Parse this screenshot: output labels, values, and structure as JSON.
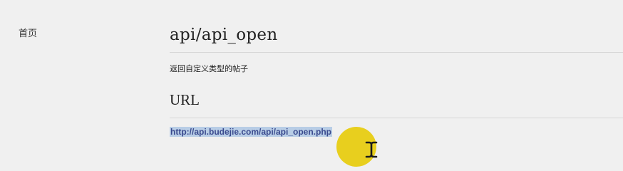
{
  "sidebar": {
    "items": [
      {
        "label": "首页"
      }
    ]
  },
  "main": {
    "title": "api/api_open",
    "description": "返回自定义类型的帖子",
    "url_heading": "URL",
    "url": "http://api.budejie.com/api/api_open.php"
  },
  "cursor": {
    "icon": "text-cursor-icon",
    "highlight_color": "#e8cf1e"
  },
  "colors": {
    "background": "#f0f0f0",
    "link": "#3a4a8e",
    "selection": "#b8cde6"
  }
}
